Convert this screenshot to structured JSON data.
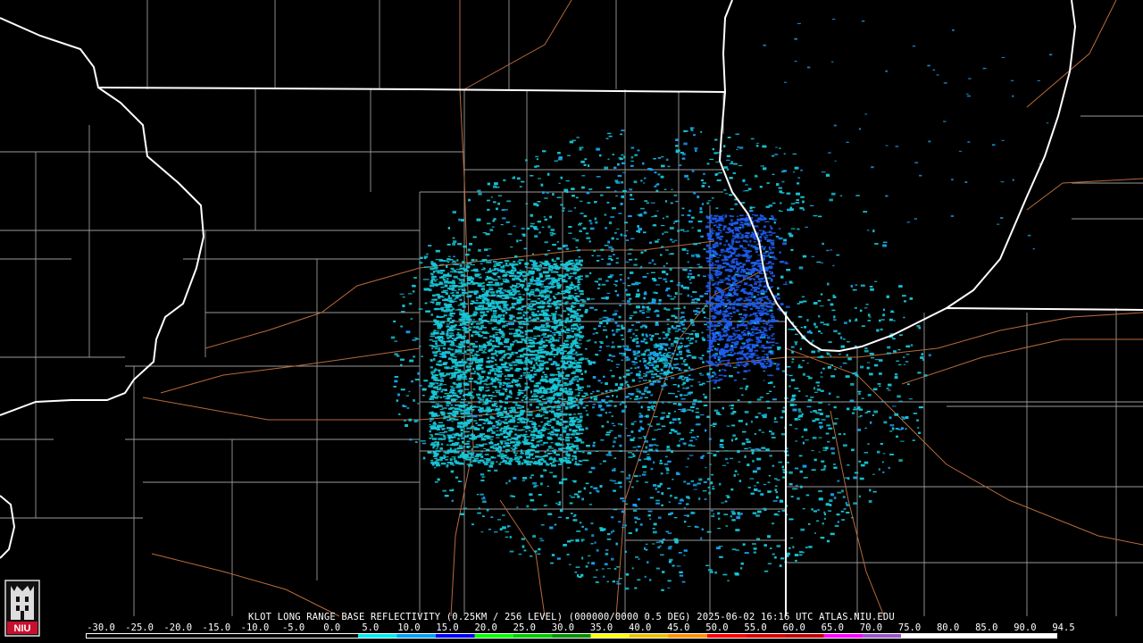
{
  "title": "KLOT LONG RANGE BASE REFLECTIVITY (0.25KM / 256 LEVEL) (000000/0000 0.5 DEG) 2025-06-02 16:16 UTC  ATLAS.NIU.EDU",
  "logo_text": "NIU",
  "scale": {
    "labels": [
      "-30.0",
      "-25.0",
      "-20.0",
      "-15.0",
      "-10.0",
      "-5.0",
      "0.0",
      "5.0",
      "10.0",
      "15.0",
      "20.0",
      "25.0",
      "30.0",
      "35.0",
      "40.0",
      "45.0",
      "50.0",
      "55.0",
      "60.0",
      "65.0",
      "70.0",
      "75.0",
      "80.0",
      "85.0",
      "90.0",
      "94.5"
    ],
    "colors": [
      "#000000",
      "#000000",
      "#000000",
      "#000000",
      "#000000",
      "#000000",
      "#000000",
      "#00ecec",
      "#01a0f6",
      "#0000f6",
      "#00ff00",
      "#00c800",
      "#009000",
      "#ffff00",
      "#e7c000",
      "#ff9000",
      "#ff0000",
      "#d60000",
      "#c00000",
      "#ff00ff",
      "#9955c9",
      "#ffffff",
      "#ffffff",
      "#ffffff",
      "#ffffff"
    ]
  },
  "colors": {
    "state_border": "#ffffff",
    "county_border": "#9a9a9a",
    "highway": "#b86a3a",
    "echo_light": "#18c8d8",
    "echo_mid": "#1aa0f0",
    "echo_strong": "#1d5cf0"
  }
}
